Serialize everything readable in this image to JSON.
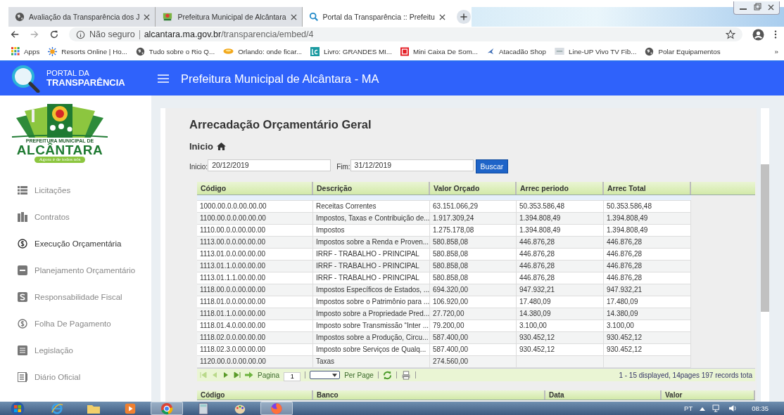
{
  "browser": {
    "tabs": [
      {
        "title": "Avaliação da Transparência dos J",
        "selected": false
      },
      {
        "title": "Prefeitura Municipal de Alcântara",
        "selected": false
      },
      {
        "title": "Portal da Transparência :: Prefeitu",
        "selected": true
      }
    ],
    "security": "Não seguro",
    "url_host": "alcantara.ma.gov.br",
    "url_path": "/transparencia/embed/4",
    "bookmarks": [
      "Apps",
      "Resorts Online | Ho...",
      "Tudo sobre o Rio Q...",
      "Orlando: onde ficar...",
      "Livro: GRANDES MI...",
      "Mini Caixa De Som...",
      "Atacadão Shop",
      "Line-UP Vivo TV Fib...",
      "Polar Equipamentos"
    ],
    "more": "»"
  },
  "header": {
    "brand_top": "PORTAL DA",
    "brand_bottom": "TRANSPARÊNCIA",
    "title": "Prefeitura Municipal de Alcântara - MA"
  },
  "logo": {
    "top": "PREFEITURA MUNICIPAL DE",
    "name": "ALCÂNTARA",
    "slogan": "Agora é de todos nós"
  },
  "sidebar": {
    "items": [
      {
        "label": "Licitações",
        "selected": false
      },
      {
        "label": "Contratos",
        "selected": false
      },
      {
        "label": "Execução Orçamentária",
        "selected": true
      },
      {
        "label": "Planejamento Orçamentário",
        "selected": false
      },
      {
        "label": "Responsabilidade Fiscal",
        "selected": false
      },
      {
        "label": "Folha De Pagamento",
        "selected": false
      },
      {
        "label": "Legislação",
        "selected": false
      },
      {
        "label": "Diário Oficial",
        "selected": false
      }
    ]
  },
  "page": {
    "title": "Arrecadação Orçamentário Geral",
    "breadcrumb": "Inicio",
    "filters": {
      "start_label": "Inicio:",
      "start_value": "20/12/2019",
      "end_label": "Fim:",
      "end_value": "31/12/2019",
      "button": "Buscar"
    },
    "table": {
      "columns": [
        "Código",
        "Descrição",
        "Valor Orçado",
        "Arrec periodo",
        "Arrec Total"
      ],
      "rows": [
        [
          "1000.00.0.0.00.00.00",
          "Receitas Correntes",
          "63.151.066,29",
          "50.353.586,48",
          "50.353.586,48"
        ],
        [
          "1100.00.0.0.00.00.00",
          "Impostos, Taxas e Contribuição de...",
          "1.917.309,24",
          "1.394.808,49",
          "1.394.808,49"
        ],
        [
          "1110.00.0.0.00.00.00",
          "Impostos",
          "1.275.178,08",
          "1.394.808,49",
          "1.394.808,49"
        ],
        [
          "1113.00.0.0.00.00.00",
          "Impostos sobre a Renda e Proven...",
          "580.858,08",
          "446.876,28",
          "446.876,28"
        ],
        [
          "1113.01.0.0.00.00.00",
          "IRRF - TRABALHO - PRINCIPAL",
          "580.858,08",
          "446.876,28",
          "446.876,28"
        ],
        [
          "1113.01.1.0.00.00.00",
          "IRRF - TRABALHO - PRINCIPAL",
          "580.858,08",
          "446.876,28",
          "446.876,28"
        ],
        [
          "1113.01.1.1.00.00.00",
          "IRRF - TRABALHO - PRINCIPAL",
          "580.858,08",
          "446.876,28",
          "446.876,28"
        ],
        [
          "1118.00.0.0.00.00.00",
          "Impostos Específicos de Estados, ...",
          "694.320,00",
          "947.932,21",
          "947.932,21"
        ],
        [
          "1118.01.0.0.00.00.00",
          "Impostos sobre o Patrimônio para ...",
          "106.920,00",
          "17.480,09",
          "17.480,09"
        ],
        [
          "1118.01.1.0.00.00.00",
          "Imposto sobre a Propriedade Pred...",
          "27.720,00",
          "14.380,09",
          "14.380,09"
        ],
        [
          "1118.01.4.0.00.00.00",
          "Imposto sobre Transmissão “Inter ...",
          "79.200,00",
          "3.100,00",
          "3.100,00"
        ],
        [
          "1118.02.0.0.00.00.00",
          "Impostos sobre a Produção, Circu...",
          "587.400,00",
          "930.452,12",
          "930.452,12"
        ],
        [
          "1118.02.3.0.00.00.00",
          "Imposto sobre Serviços de Qualq...",
          "587.400,00",
          "930.452,12",
          "930.452,12"
        ],
        [
          "1120.00.0.0.00.00.00",
          "Taxas",
          "274.560,00",
          null,
          null
        ]
      ],
      "pager": {
        "page_label": "Pagina",
        "page": "1",
        "per_page": "Per Page",
        "summary": "1 - 15 displayed, 14pages 197 records tota"
      }
    },
    "second_table": {
      "columns": [
        "Código",
        "Banco",
        "Data",
        "Valor"
      ]
    }
  },
  "taskbar": {
    "apps": [
      {
        "active": false
      },
      {
        "active": false
      },
      {
        "active": false
      },
      {
        "active": true
      },
      {
        "active": false
      },
      {
        "active": false
      },
      {
        "active": true
      }
    ],
    "language": "PT",
    "time": "08:35"
  }
}
